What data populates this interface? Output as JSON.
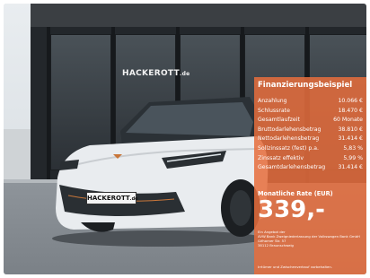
{
  "dealer": {
    "name": "HACKEROTT",
    "suffix": ".de"
  },
  "finance": {
    "title": "Finanzierungsbeispiel",
    "rows": [
      {
        "label": "Anzahlung",
        "value": "10.066 €"
      },
      {
        "label": "Schlussrate",
        "value": "18.470 €"
      },
      {
        "label": "Gesamtlaufzeit",
        "value": "60 Monate"
      },
      {
        "label": "Bruttodarlehensbetrag",
        "value": "38.810 €"
      },
      {
        "label": "Nettodarlehensbetrag",
        "value": "31.414 €"
      },
      {
        "label": "Sollzinssatz (fest) p.a.",
        "value": "5,83 %"
      },
      {
        "label": "Zinssatz effektiv",
        "value": "5,99 %"
      },
      {
        "label": "Gesamtdarlehensbetrag",
        "value": "31.414 €"
      }
    ],
    "rate_label": "Monatliche Rate (EUR)",
    "rate_value": "339,-",
    "small_print": "Ein Angebot der\nAVW Bank Zweigniederlassung der Volkswagen Bank GmbH\nGifhorner Str. 57\n38112 Braunschweig",
    "footer": "Irrtümer und Zwischenverkauf vorbehalten."
  },
  "colors": {
    "panel": "#e66e3c",
    "building": "#23272b",
    "car_body": "#e9ecef",
    "accent": "#c8763a"
  }
}
